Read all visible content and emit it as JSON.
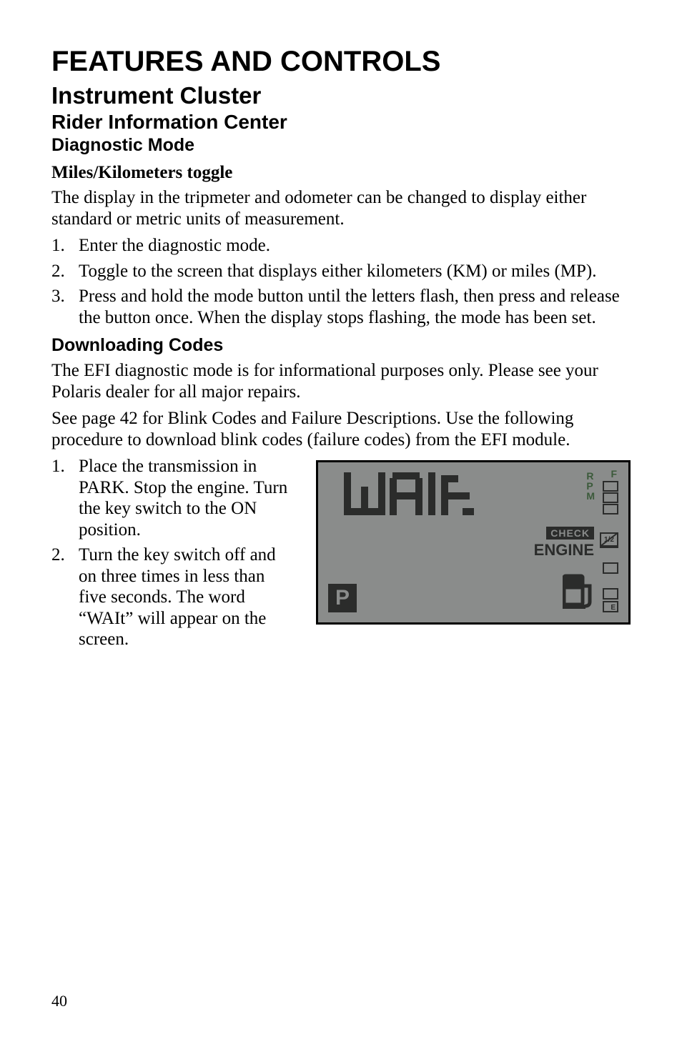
{
  "page_number": "40",
  "h1": "FEATURES AND CONTROLS",
  "h2": "Instrument Cluster",
  "h3": "Rider Information Center",
  "h4": "Diagnostic Mode",
  "section1": {
    "title": "Miles/Kilometers toggle",
    "intro": "The display in the tripmeter and odometer can be changed to display either standard or metric units of measurement.",
    "steps": [
      "Enter the diagnostic mode.",
      "Toggle to the screen that displays either kilometers (KM) or miles (MP).",
      "Press and hold the mode button until the letters flash, then press and release the button once. When the display stops flashing, the mode has been set."
    ]
  },
  "section2": {
    "title": "Downloading Codes",
    "p1": "The EFI diagnostic mode is for informational purposes only. Please see your Polaris dealer for all major repairs.",
    "p2": "See page 42 for Blink Codes and Failure Descriptions. Use the following procedure to download blink codes (failure codes) from the EFI module.",
    "steps": [
      "Place the transmission in PARK. Stop the engine. Turn the key switch to the ON position.",
      "Turn the key switch off and on three times in less than five seconds. The word “WAIt” will appear on the screen."
    ]
  },
  "lcd": {
    "wait_text": "WAIt",
    "gears": [
      "R",
      "P",
      "M"
    ],
    "gear_f": "F",
    "check_label": "CHECK",
    "engine_label": "ENGINE",
    "half": "1/2",
    "park": "P",
    "e_label": "E"
  }
}
